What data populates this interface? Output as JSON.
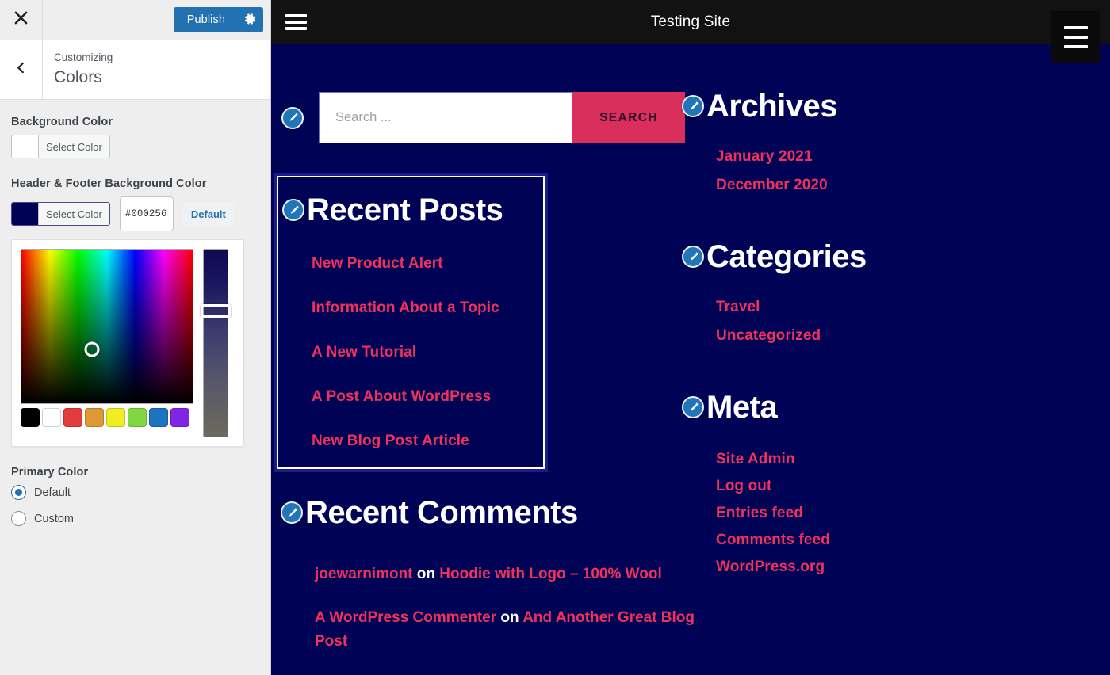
{
  "customizer": {
    "close_icon": "close-icon",
    "publish_label": "Publish",
    "gear_icon": "gear-icon",
    "back_icon": "chevron-left-icon",
    "breadcrumb": "Customizing",
    "panel_title": "Colors",
    "controls": {
      "background_color": {
        "label": "Background Color",
        "select_label": "Select Color",
        "swatch": "#ffffff"
      },
      "header_footer_color": {
        "label": "Header & Footer Background Color",
        "select_label": "Select Color",
        "swatch": "#000256",
        "hex_value": "#000256",
        "default_label": "Default"
      },
      "primary_color": {
        "label": "Primary Color",
        "options": [
          {
            "label": "Default",
            "checked": true
          },
          {
            "label": "Custom",
            "checked": false
          }
        ]
      }
    },
    "palette": [
      "#000000",
      "#ffffff",
      "#e23c3c",
      "#dd9933",
      "#eeee22",
      "#81d742",
      "#1e73be",
      "#8224e3"
    ]
  },
  "preview": {
    "site_title": "Testing Site",
    "menu_icon": "hamburger-menu-icon",
    "menu_box_icon": "hamburger-menu-icon",
    "edit_icon": "pencil-edit-icon",
    "search": {
      "placeholder": "Search ...",
      "value": "",
      "button_label": "SEARCH"
    },
    "widgets": {
      "recent_posts": {
        "title": "Recent Posts",
        "links": [
          "New Product Alert",
          "Information About a Topic",
          "A New Tutorial",
          "A Post About WordPress",
          "New Blog Post Article"
        ]
      },
      "recent_comments": {
        "title": "Recent Comments",
        "items": [
          {
            "author": "joewarnimont",
            "on": "on",
            "post": "Hoodie with Logo – 100% Wool"
          },
          {
            "author": "A WordPress Commenter",
            "on": "on",
            "post": "And Another Great Blog Post"
          }
        ]
      },
      "archives": {
        "title": "Archives",
        "links": [
          "January 2021",
          "December 2020"
        ]
      },
      "categories": {
        "title": "Categories",
        "links": [
          "Travel",
          "Uncategorized"
        ]
      },
      "meta": {
        "title": "Meta",
        "links": [
          "Site Admin",
          "Log out",
          "Entries feed",
          "Comments feed",
          "WordPress.org"
        ]
      }
    }
  },
  "colors": {
    "site_background": "#000256",
    "header_background": "#121212",
    "accent_pink": "#ef315c",
    "search_button": "#d92f5a",
    "publish_blue": "#2271b1",
    "highlight_border": "#1c1b8d"
  }
}
